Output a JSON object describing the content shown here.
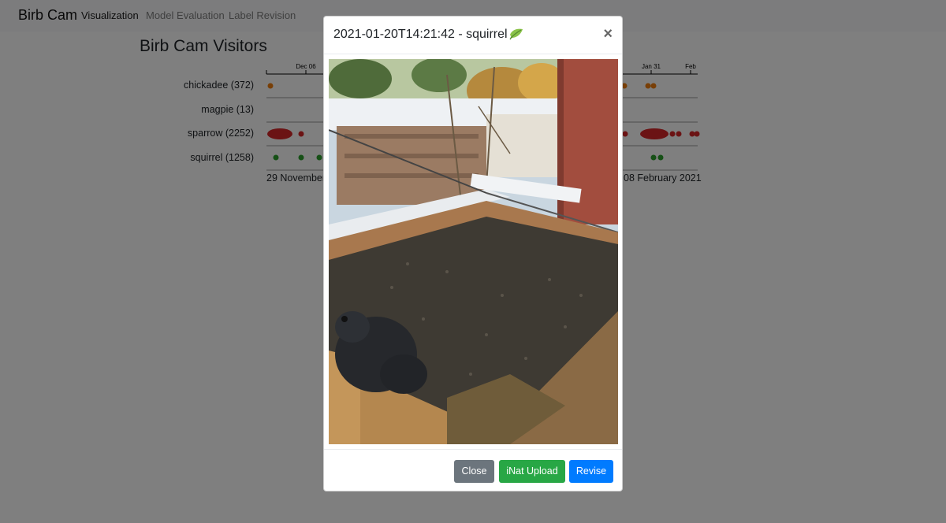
{
  "navbar": {
    "brand": "Birb Cam",
    "links": [
      "Visualization",
      "Model Evaluation",
      "Label Revision"
    ]
  },
  "page": {
    "title": "Birb Cam Visitors"
  },
  "timeline": {
    "top_ticks": [
      "Dec 06",
      "Jan 31",
      "Feb"
    ],
    "rows": [
      {
        "label": "chickadee (372)",
        "color": "#f07f0e"
      },
      {
        "label": "magpie (13)",
        "color": "#1f77b4"
      },
      {
        "label": "sparrow (2252)",
        "color": "#d62728"
      },
      {
        "label": "squirrel (1258)",
        "color": "#2ca02c"
      }
    ],
    "start_label": "29 November",
    "end_label": "08 February 2021"
  },
  "modal": {
    "title": "2021-01-20T14:21:42 - squirrel",
    "title_icon": "leaf-icon",
    "close_symbol": "×",
    "buttons": {
      "close": "Close",
      "inat": "iNat Upload",
      "revise": "Revise"
    }
  },
  "colors": {
    "secondary": "#6c757d",
    "success": "#28a745",
    "primary": "#007bff"
  }
}
